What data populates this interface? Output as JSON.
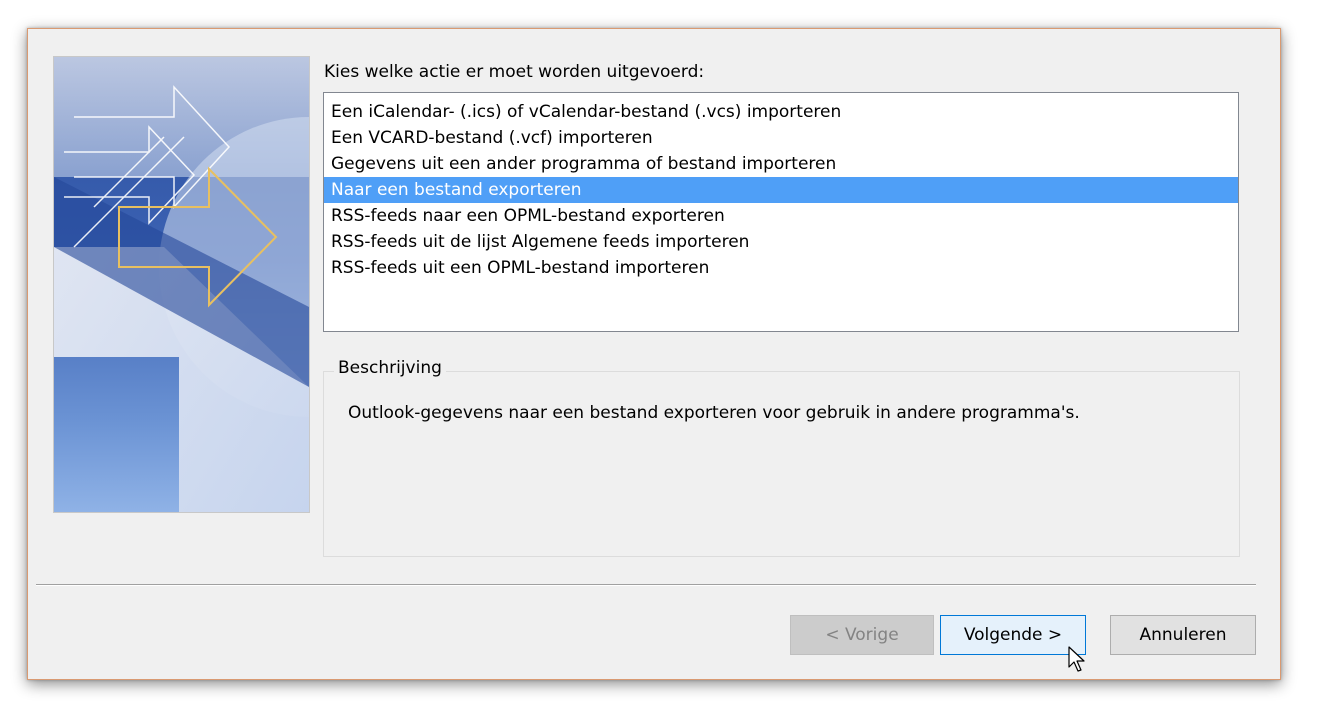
{
  "prompt": "Kies welke actie er moet worden uitgevoerd:",
  "actions": [
    "Een iCalendar- (.ics) of vCalendar-bestand (.vcs) importeren",
    "Een VCARD-bestand (.vcf) importeren",
    "Gegevens uit een ander programma of bestand importeren",
    "Naar een bestand exporteren",
    "RSS-feeds naar een OPML-bestand exporteren",
    "RSS-feeds uit de lijst Algemene feeds importeren",
    "RSS-feeds uit een OPML-bestand importeren"
  ],
  "selected_action_index": 3,
  "description": {
    "title": "Beschrijving",
    "text": "Outlook-gegevens naar een bestand exporteren voor gebruik in andere programma's."
  },
  "buttons": {
    "previous": "< Vorige",
    "next": "Volgende >",
    "cancel": "Annuleren"
  },
  "previous_enabled": false,
  "colors": {
    "selection": "#4f9ff7",
    "accent_border": "#0078d7",
    "window_border": "#d99a72",
    "dialog_bg": "#f0f0f0"
  }
}
